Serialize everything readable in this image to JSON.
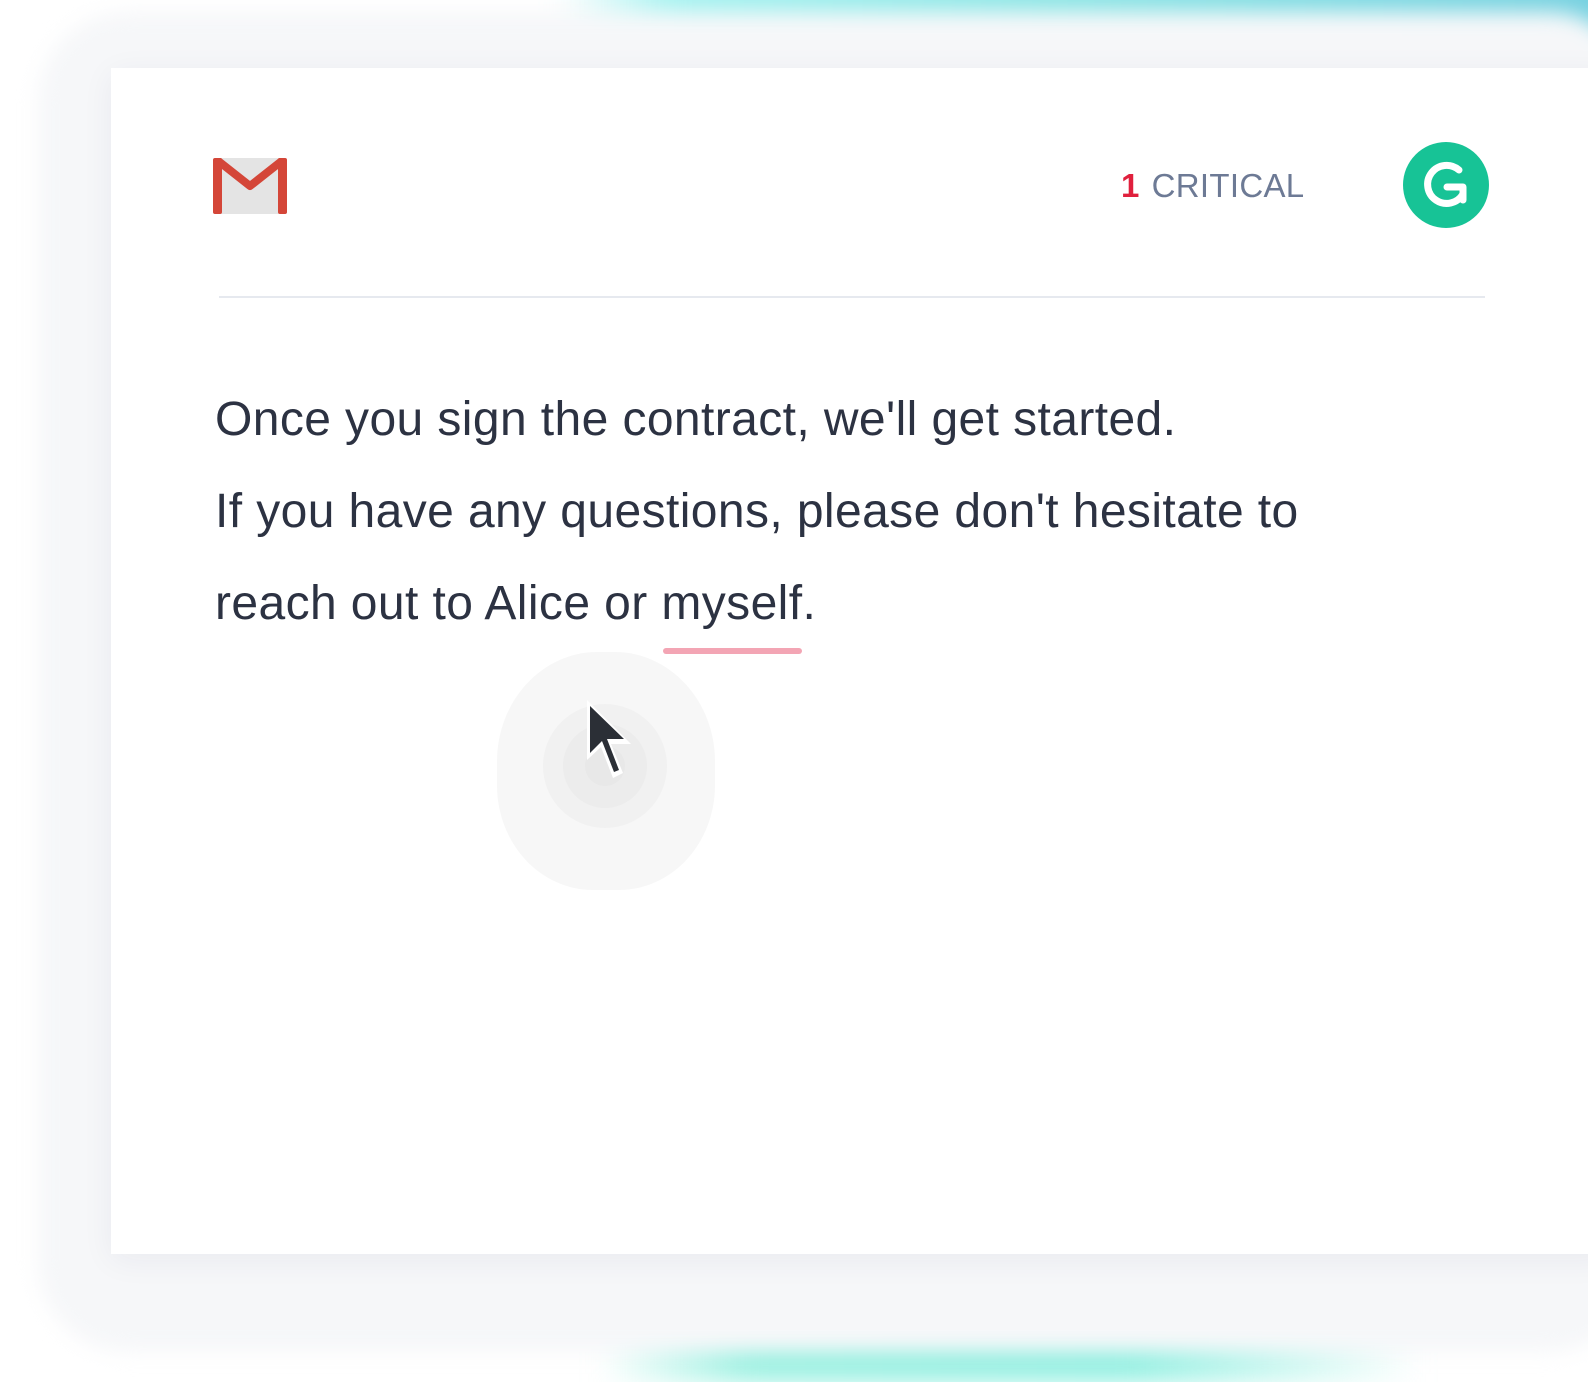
{
  "header": {
    "app_icon": "gmail-icon",
    "critical_count": "1",
    "critical_label": "CRITICAL",
    "assistant_icon": "grammarly-g-icon"
  },
  "editor": {
    "line1": "Once you sign the contract, we'll get started.",
    "line2": "If you have any questions, please don't hesitate to",
    "line3_prefix": "reach out to Alice or ",
    "flagged_word": "myself",
    "line3_suffix": "."
  },
  "colors": {
    "critical_red": "#e0203d",
    "grammarly_green": "#17c396",
    "underline_pink": "#f3a5b4",
    "gmail_red": "#d44638",
    "text": "#2c3242"
  },
  "cursor": {
    "icon": "mouse-pointer-icon"
  }
}
